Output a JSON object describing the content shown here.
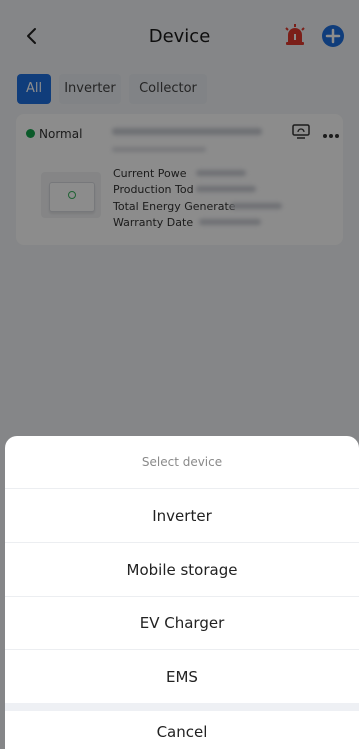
{
  "header": {
    "title": "Device"
  },
  "tabs": [
    {
      "label": "All",
      "active": true
    },
    {
      "label": "Inverter",
      "active": false
    },
    {
      "label": "Collector",
      "active": false
    }
  ],
  "device_card": {
    "status": "Normal",
    "status_color": "#14a44d",
    "fields": [
      {
        "label": "Current Powe"
      },
      {
        "label": "Production Tod"
      },
      {
        "label": "Total Energy Generate"
      },
      {
        "label": "Warranty Date"
      }
    ]
  },
  "sheet": {
    "title": "Select device",
    "options": [
      "Inverter",
      "Mobile storage",
      "EV Charger",
      "EMS"
    ],
    "cancel": "Cancel"
  },
  "colors": {
    "accent": "#1e6fe0",
    "alarm": "#e03a2f"
  }
}
